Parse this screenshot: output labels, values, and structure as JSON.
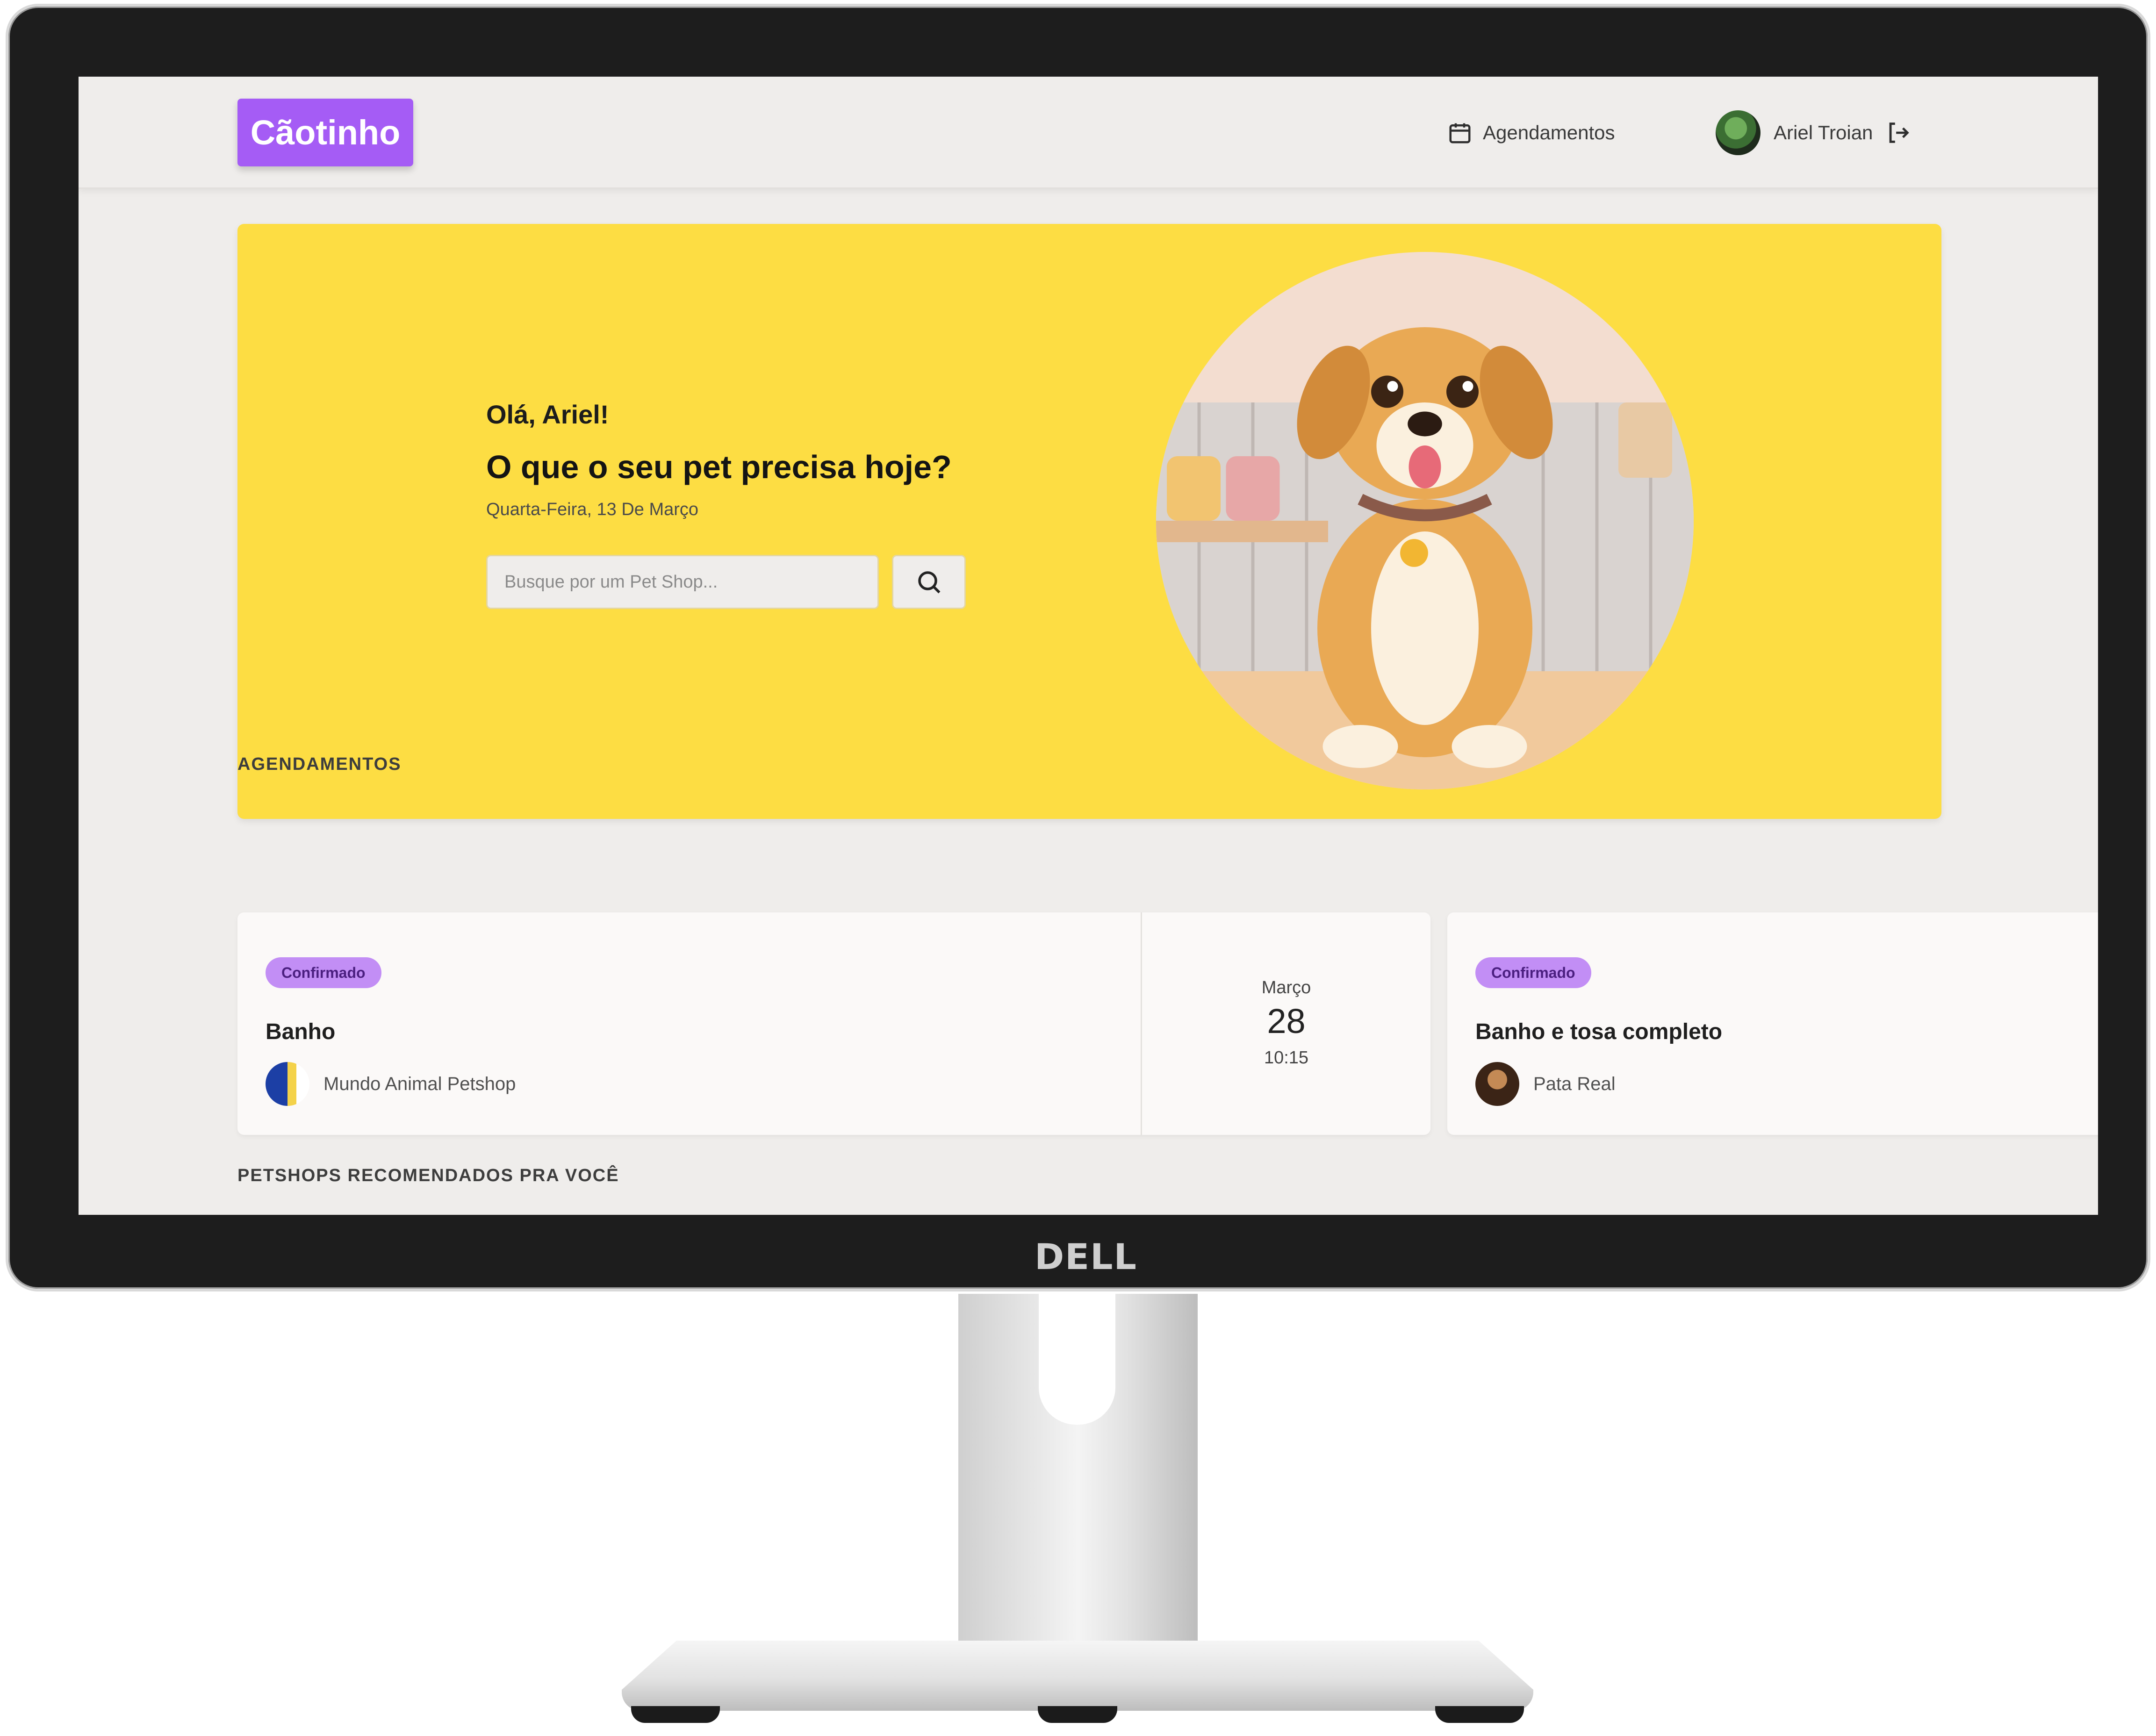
{
  "monitor": {
    "brand": "DELL"
  },
  "header": {
    "logo": "Cãotinho",
    "nav_appointments": "Agendamentos",
    "user_name": "Ariel Troian"
  },
  "hero": {
    "greeting": "Olá, Ariel!",
    "question": "O que o seu pet precisa hoje?",
    "date": "Quarta-Feira, 13 De Março",
    "search_placeholder": "Busque por um Pet Shop...",
    "image_subject": "cartoon dog in pet shop"
  },
  "sections": {
    "appointments_title": "AGENDAMENTOS",
    "recommended_title": "PETSHOPS RECOMENDADOS PRA VOCÊ"
  },
  "appointments": [
    {
      "status": "Confirmado",
      "service": "Banho",
      "shop": "Mundo Animal Petshop",
      "month": "Março",
      "day": "28",
      "time": "10:15"
    },
    {
      "status": "Confirmado",
      "service": "Banho e tosa completo",
      "shop": "Pata Real"
    }
  ],
  "colors": {
    "brand": "#a55cf5",
    "hero_bg": "#fddd43",
    "badge_bg": "#c28ef5",
    "page_bg": "#efedeb"
  },
  "icons": {
    "nav": "calendar-icon",
    "logout": "logout-icon",
    "search": "search-icon"
  }
}
